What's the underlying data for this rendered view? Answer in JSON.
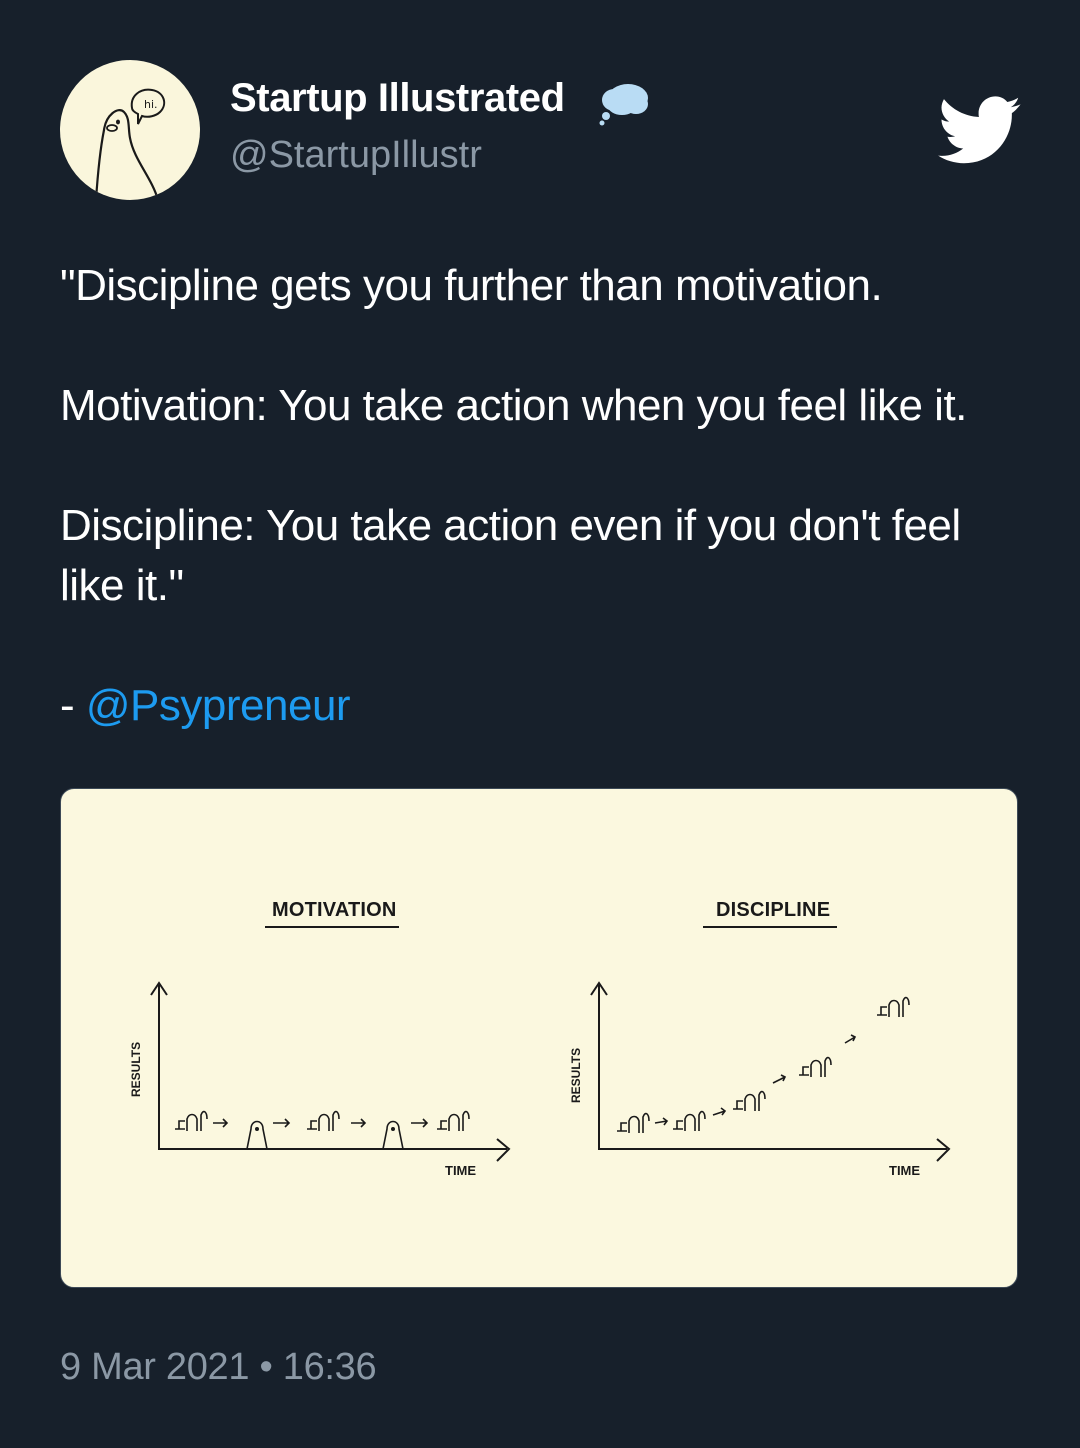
{
  "author": {
    "display_name": "Startup Illustrated",
    "handle": "@StartupIllustr",
    "avatar_speech": "hi.",
    "badge_icon": "thought-bubble-icon"
  },
  "brand": {
    "icon": "twitter-bird-icon",
    "color": "#ffffff"
  },
  "tweet": {
    "line1": "\"Discipline gets you further than motivation.",
    "line2": "Motivation: You take action when you feel like it.",
    "line3": "Discipline: You take action even if you don't feel like it.\"",
    "attribution_prefix": "- ",
    "attribution_mention": "@Psypreneur",
    "mention_color": "#1d9bf0"
  },
  "media": {
    "background": "#fbf8df",
    "charts": [
      {
        "title": "MOTIVATION",
        "xlabel": "TIME",
        "ylabel": "RESULTS",
        "pattern": "work, pause, work, pause, work — results stay flat"
      },
      {
        "title": "DISCIPLINE",
        "xlabel": "TIME",
        "ylabel": "RESULTS",
        "pattern": "work repeated continuously — results rise steadily"
      }
    ]
  },
  "timestamp": "9 Mar 2021 • 16:36",
  "colors": {
    "background": "#17202b",
    "secondary_text": "#8b98a5"
  }
}
